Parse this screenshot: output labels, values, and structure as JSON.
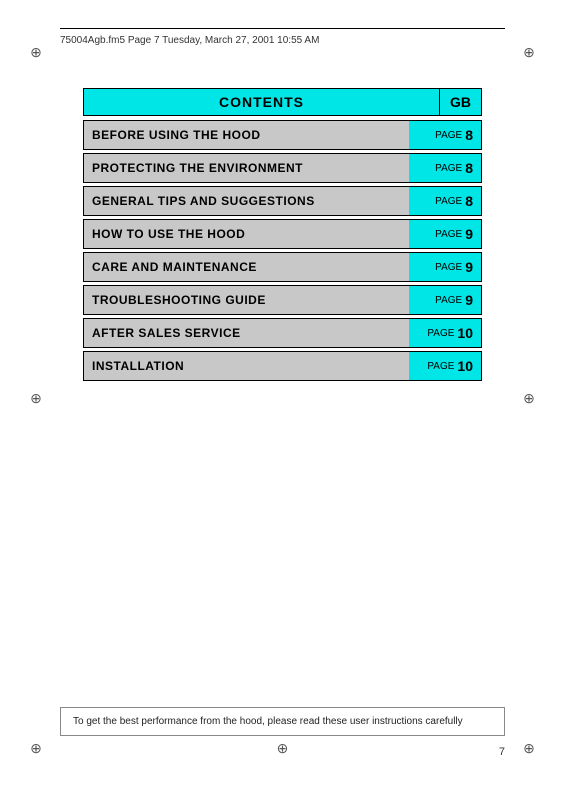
{
  "header": {
    "filename": "75004Agb.fm5  Page 7  Tuesday, March 27, 2001  10:55 AM"
  },
  "contents": {
    "title": "CONTENTS",
    "gb_label": "GB",
    "rows": [
      {
        "label": "BEFORE USING THE HOOD",
        "page_word": "PAGE",
        "page_num": "8"
      },
      {
        "label": "PROTECTING THE ENVIRONMENT",
        "page_word": "PAGE",
        "page_num": "8"
      },
      {
        "label": "GENERAL TIPS AND SUGGESTIONS",
        "page_word": "PAGE",
        "page_num": "8"
      },
      {
        "label": "HOW TO USE THE HOOD",
        "page_word": "PAGE",
        "page_num": "9"
      },
      {
        "label": "CARE AND MAINTENANCE",
        "page_word": "PAGE",
        "page_num": "9"
      },
      {
        "label": "TROUBLESHOOTING GUIDE",
        "page_word": "PAGE",
        "page_num": "9"
      },
      {
        "label": "AFTER SALES SERVICE",
        "page_word": "PAGE",
        "page_num": "10"
      },
      {
        "label": "INSTALLATION",
        "page_word": "PAGE",
        "page_num": "10"
      }
    ]
  },
  "bottom_note": "To get the best performance from the hood, please read these user instructions carefully",
  "page_number": "7"
}
